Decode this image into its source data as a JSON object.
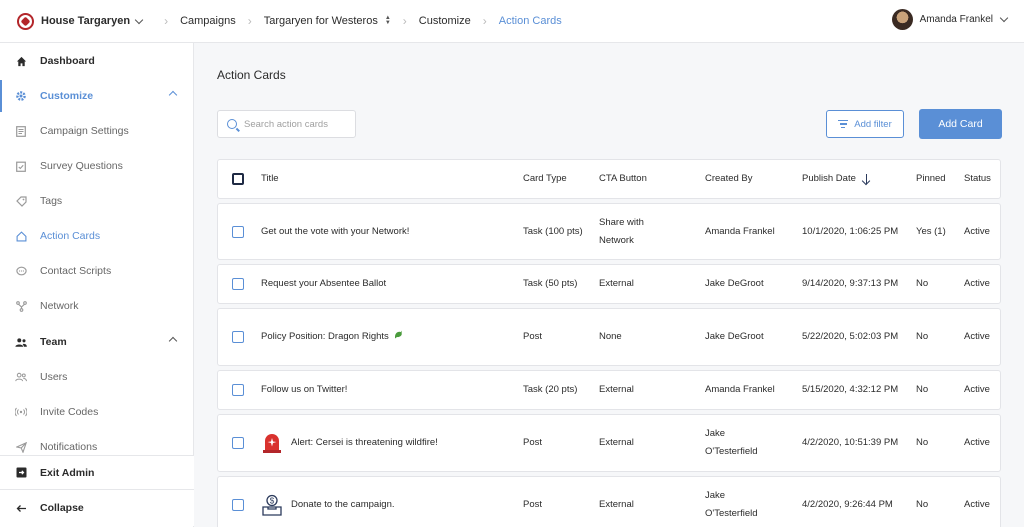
{
  "topbar": {
    "org_name": "House Targaryen",
    "crumbs": [
      "Campaigns",
      "Targaryen for Westeros",
      "Customize",
      "Action Cards"
    ],
    "user_name": "Amanda Frankel"
  },
  "sidebar": {
    "dashboard": "Dashboard",
    "customize": "Customize",
    "campaign_settings": "Campaign Settings",
    "survey_questions": "Survey Questions",
    "tags": "Tags",
    "action_cards": "Action Cards",
    "contact_scripts": "Contact Scripts",
    "network": "Network",
    "team": "Team",
    "users": "Users",
    "invite_codes": "Invite Codes",
    "notifications": "Notifications",
    "exit_admin": "Exit Admin",
    "collapse": "Collapse"
  },
  "main": {
    "title": "Action Cards",
    "search_placeholder": "Search action cards",
    "add_filter": "Add filter",
    "add_card": "Add Card"
  },
  "table": {
    "columns": {
      "title": "Title",
      "card_type": "Card Type",
      "cta_button": "CTA Button",
      "created_by": "Created By",
      "publish_date": "Publish Date",
      "pinned": "Pinned",
      "status": "Status"
    },
    "rows": [
      {
        "title": "Get out the vote with your Network!",
        "card_type": "Task (100 pts)",
        "cta": "Share with Network",
        "created_by": "Amanda Frankel",
        "publish_date": "10/1/2020, 1:06:25 PM",
        "pinned": "Yes (1)",
        "status": "Active"
      },
      {
        "title": "Request your Absentee Ballot",
        "card_type": "Task (50 pts)",
        "cta": "External",
        "created_by": "Jake DeGroot",
        "publish_date": "9/14/2020, 9:37:13 PM",
        "pinned": "No",
        "status": "Active"
      },
      {
        "title": "Policy Position: Dragon Rights",
        "card_type": "Post",
        "cta": "None",
        "created_by": "Jake DeGroot",
        "publish_date": "5/22/2020, 5:02:03 PM",
        "pinned": "No",
        "status": "Active"
      },
      {
        "title": "Follow us on Twitter!",
        "card_type": "Task (20 pts)",
        "cta": "External",
        "created_by": "Amanda Frankel",
        "publish_date": "5/15/2020, 4:32:12 PM",
        "pinned": "No",
        "status": "Active"
      },
      {
        "title": "Alert: Cersei is threatening wildfire!",
        "card_type": "Post",
        "cta": "External",
        "created_by": "Jake O'Testerfield",
        "publish_date": "4/2/2020, 10:51:39 PM",
        "pinned": "No",
        "status": "Active"
      },
      {
        "title": "Donate to the campaign.",
        "card_type": "Post",
        "cta": "External",
        "created_by": "Jake O'Testerfield",
        "publish_date": "4/2/2020, 9:26:44 PM",
        "pinned": "No",
        "status": "Active"
      }
    ]
  },
  "colors": {
    "accent": "#5a8fd6",
    "alert": "#d9322e",
    "dragon": "#4a9b3c"
  }
}
